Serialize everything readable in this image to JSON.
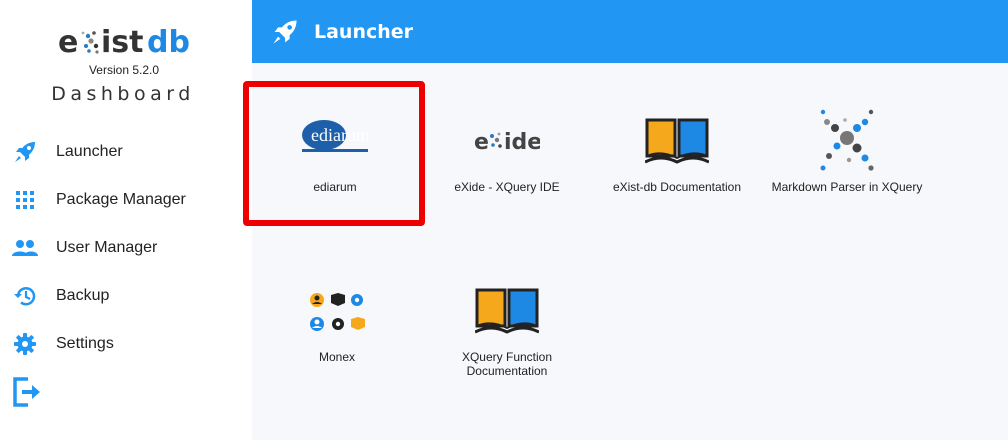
{
  "app": {
    "logo_text": "existdb",
    "version": "Version 5.2.0",
    "subtitle": "Dashboard"
  },
  "sidebar": {
    "items": [
      {
        "label": "Launcher",
        "icon": "rocket-icon"
      },
      {
        "label": "Package Manager",
        "icon": "grid-icon"
      },
      {
        "label": "User Manager",
        "icon": "users-icon"
      },
      {
        "label": "Backup",
        "icon": "history-icon"
      },
      {
        "label": "Settings",
        "icon": "gear-icon"
      },
      {
        "label": "",
        "icon": "logout-icon"
      }
    ]
  },
  "header": {
    "title": "Launcher",
    "icon": "rocket-icon"
  },
  "apps": [
    {
      "label": "ediarum",
      "logo_text": "ediarum"
    },
    {
      "label": "eXide - XQuery IDE",
      "logo_text": "exide"
    },
    {
      "label": "eXist-db Documentation"
    },
    {
      "label": "Markdown Parser in XQuery"
    },
    {
      "label": "Monex"
    },
    {
      "label": "XQuery Function Documentation"
    }
  ],
  "colors": {
    "accent": "#2196f3",
    "highlight": "#ee0000",
    "book_yellow": "#f5a81c",
    "book_blue": "#1e88e5"
  }
}
